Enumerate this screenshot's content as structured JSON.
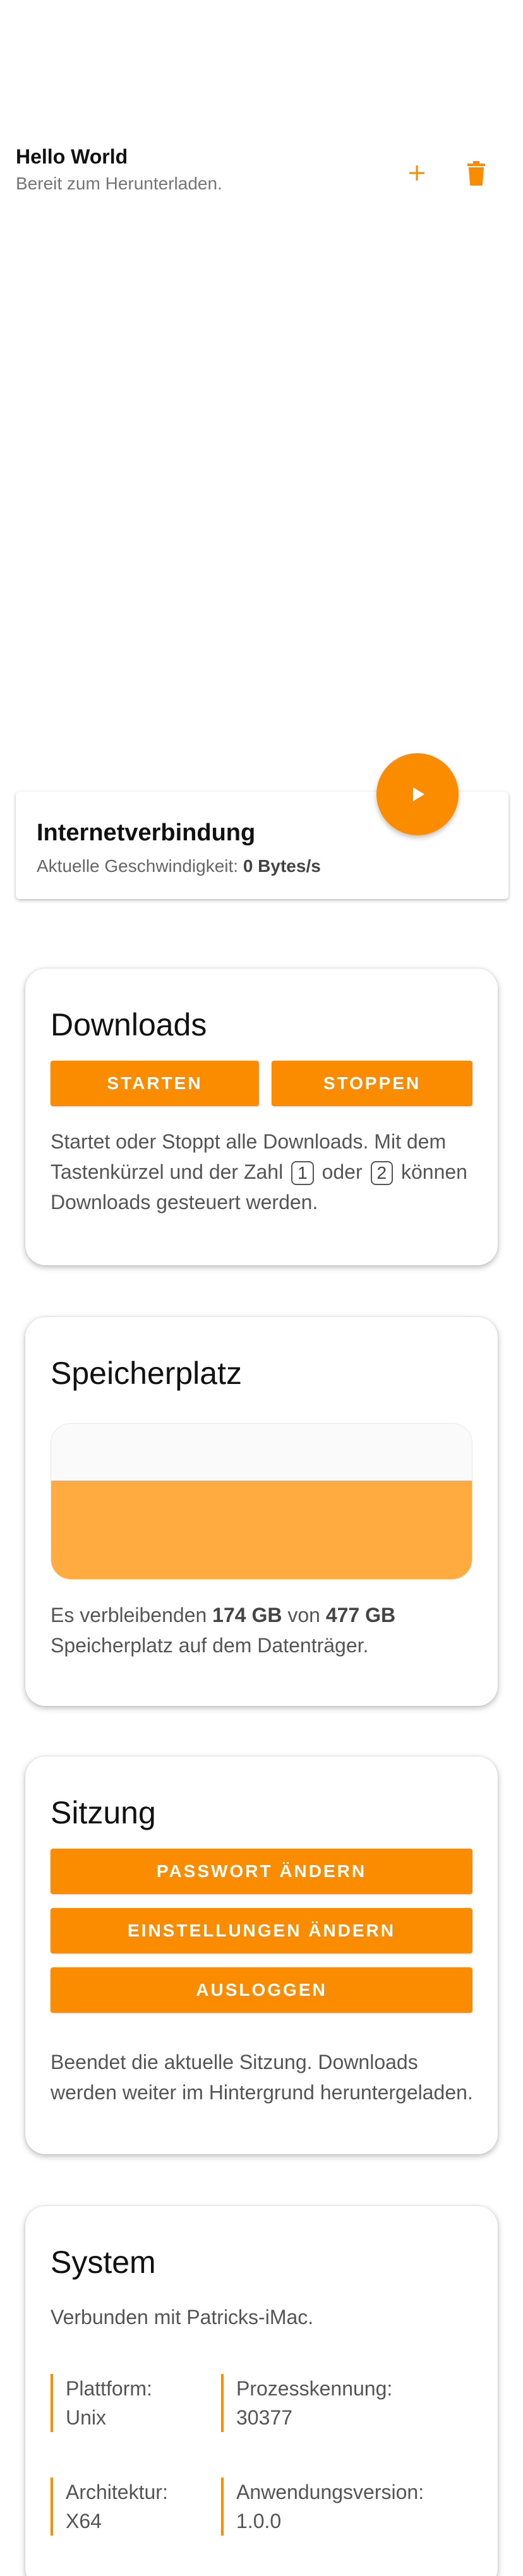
{
  "task": {
    "title": "Hello World",
    "status": "Bereit zum Herunterladen."
  },
  "icons": {
    "add": "plus-icon",
    "delete": "trash-icon",
    "play": "play-icon"
  },
  "colors": {
    "accent": "#fb8c00",
    "storage_fill": "#ffab40"
  },
  "internet": {
    "title": "Internetverbindung",
    "speed_label": "Aktuelle Geschwindigkeit:",
    "speed_value": "0 Bytes/s"
  },
  "downloads": {
    "title": "Downloads",
    "start_label": "STARTEN",
    "stop_label": "STOPPEN",
    "desc_1": "Startet oder Stoppt alle Downloads. Mit dem Tastenkürzel und der Zahl",
    "key_1": "1",
    "desc_2": "oder",
    "key_2": "2",
    "desc_3": "können Downloads gesteuert werden."
  },
  "storage": {
    "title": "Speicherplatz",
    "used_fraction": 0.635,
    "desc_prefix": "Es verbleibenden",
    "free": "174 GB",
    "desc_mid": "von",
    "total": "477 GB",
    "desc_suffix": "Speicherplatz auf dem Datenträger."
  },
  "session": {
    "title": "Sitzung",
    "change_password": "PASSWORT ÄNDERN",
    "change_settings": "EINSTELLUNGEN ÄNDERN",
    "logout": "AUSLOGGEN",
    "desc": "Beendet die aktuelle Sitzung. Downloads werden weiter im Hintergrund heruntergeladen."
  },
  "system": {
    "title": "System",
    "connected": "Verbunden mit Patricks-iMac.",
    "platform_label": "Plattform:",
    "platform_value": "Unix",
    "pid_label": "Prozesskennung:",
    "pid_value": "30377",
    "arch_label": "Architektur:",
    "arch_value": "X64",
    "version_label": "Anwendungsversion:",
    "version_value": "1.0.0"
  }
}
